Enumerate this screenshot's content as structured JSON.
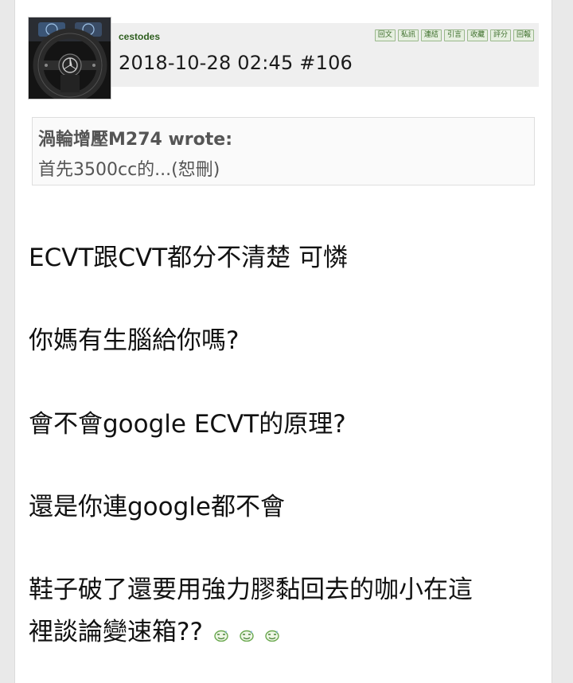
{
  "post": {
    "username": "cestodes",
    "meta": "2018-10-28 02:45  #106",
    "actions": [
      {
        "label": "回文"
      },
      {
        "label": "私訊"
      },
      {
        "label": "連結"
      },
      {
        "label": "引言"
      },
      {
        "label": "收藏"
      },
      {
        "label": "評分"
      },
      {
        "label": "回報"
      }
    ]
  },
  "quote": {
    "author": "渦輪增壓M274 wrote:",
    "text": "首先3500cc的...(恕刪)"
  },
  "body": {
    "lines": [
      "ECVT跟CVT都分不清楚 可憐",
      "你媽有生腦給你嗎?",
      "會不會google ECVT的原理?",
      "還是你連google都不會",
      "鞋子破了還要用強力膠黏回去的咖小在這",
      "裡談論變速箱??"
    ]
  },
  "emoji_names": [
    "sweat-smiley-icon",
    "sweat-smiley-icon",
    "sweat-smiley-icon"
  ],
  "colors": {
    "username": "#2e5e1e",
    "action_border": "#9ab88c",
    "action_bg": "#e6efe0",
    "emoji": "#6aa84f"
  }
}
